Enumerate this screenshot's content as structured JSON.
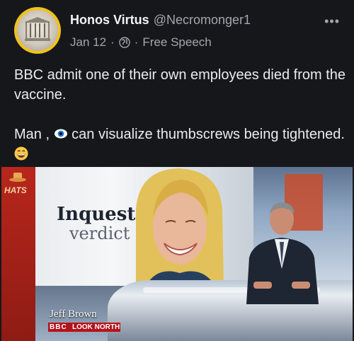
{
  "post": {
    "author": {
      "display_name": "Honos Virtus",
      "handle": "@Necromonger1"
    },
    "date": "Jan 12",
    "separator": "·",
    "visibility_icon": "globe-icon",
    "community": "Free Speech",
    "more_label": "•••",
    "text": {
      "para1": "BBC admit one of their own employees died from the vaccine.",
      "para2_prefix": "Man , ",
      "para2_emoji1": "eye-emoji",
      "para2_middle": " can visualize thumbscrews being tightened. ",
      "para2_emoji2": "grinning-emoji"
    },
    "media": {
      "screen_title": "Inquest",
      "screen_subtitle": "verdict",
      "caption_name": "Jeff Brown",
      "caption_bbc": "BBC",
      "caption_station": "LOOK NORTH",
      "corner_logo": "HATS"
    }
  },
  "colors": {
    "background": "#16171b",
    "avatar_ring": "#f2c21b",
    "muted_text": "#a4a6ad",
    "bbc_red": "#b5121b"
  }
}
